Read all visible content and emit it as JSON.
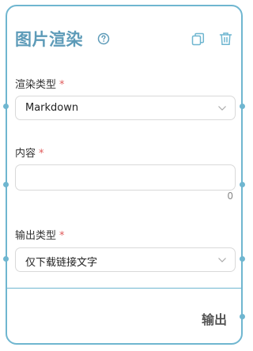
{
  "node": {
    "title": "图片渲染",
    "icons": {
      "help": "help-circle-icon",
      "copy": "copy-icon",
      "delete": "trash-icon"
    },
    "fields": [
      {
        "label": "渲染类型",
        "required_mark": "*",
        "value": "Markdown"
      },
      {
        "label": "内容",
        "required_mark": "*",
        "value": "",
        "char_count": "0"
      },
      {
        "label": "输出类型",
        "required_mark": "*",
        "value": "仅下载链接文字"
      }
    ],
    "output_label": "输出",
    "colors": {
      "accent": "#6fb6d0",
      "title": "#5d9bb8",
      "required": "#e05a5a"
    }
  }
}
